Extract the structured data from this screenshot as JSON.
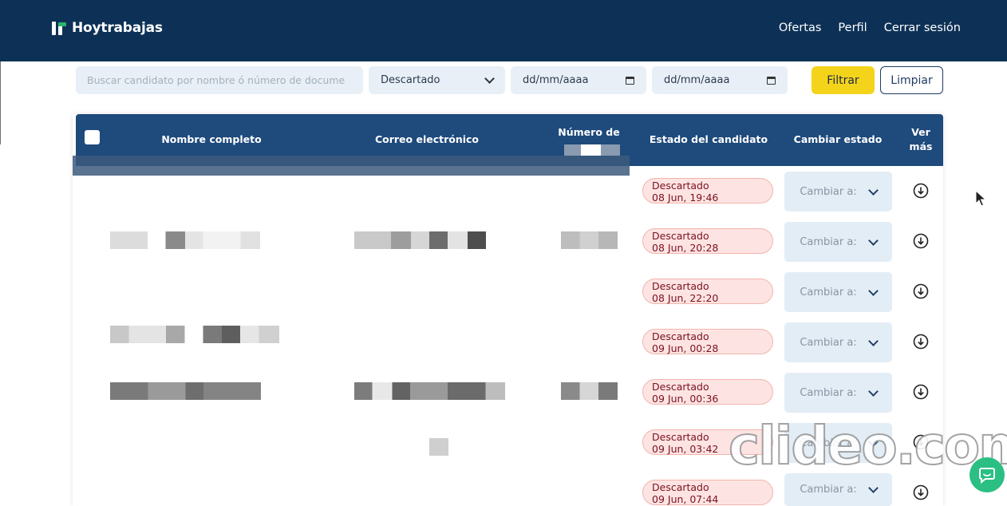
{
  "brand": {
    "name": "Hoytrabajas"
  },
  "nav": {
    "items": [
      "Ofertas",
      "Perfil",
      "Cerrar sesión"
    ]
  },
  "filters": {
    "search_placeholder": "Buscar candidato por nombre ó número de docume",
    "status_selected": "Descartado",
    "date_from": "dd/mm/aaaa",
    "date_to": "dd/mm/aaaa",
    "filter_label": "Filtrar",
    "clear_label": "Limpiar"
  },
  "table": {
    "headers": {
      "full_name": "Nombre completo",
      "email": "Correo electrónico",
      "doc_number": "Número de",
      "status": "Estado del candidato",
      "change_status": "Cambiar estado",
      "see_more_1": "Ver",
      "see_more_2": "más"
    },
    "change_placeholder": "Cambiar a:",
    "rows": [
      {
        "status": "Descartado",
        "date": "08 Jun, 19:46"
      },
      {
        "status": "Descartado",
        "date": "08 Jun, 20:28"
      },
      {
        "status": "Descartado",
        "date": "08 Jun, 22:20"
      },
      {
        "status": "Descartado",
        "date": "09 Jun, 00:28"
      },
      {
        "status": "Descartado",
        "date": "09 Jun, 00:36"
      },
      {
        "status": "Descartado",
        "date": "09 Jun, 03:42"
      },
      {
        "status": "Descartado",
        "date": "09 Jun, 07:44"
      }
    ]
  },
  "watermark": "clideo.com",
  "colors": {
    "navbar": "#0d3156",
    "table_header": "#1e4a7c",
    "accent_yellow": "#f3d41b",
    "badge_bg": "#fde4e2",
    "badge_text": "#7a1020",
    "chat": "#2bbf84"
  }
}
